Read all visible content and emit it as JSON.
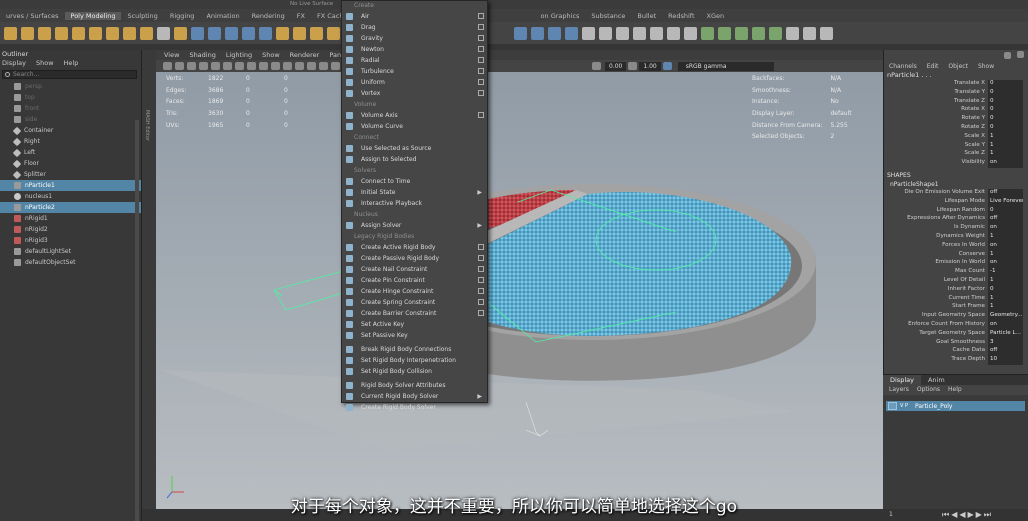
{
  "top": {
    "status": "No Live Surface"
  },
  "shelf_tabs": [
    "urves / Surfaces",
    "Poly Modeling",
    "Sculpting",
    "Rigging",
    "Animation",
    "Rendering",
    "FX",
    "FX Caching",
    "on Graphics",
    "Substance",
    "Bullet",
    "Redshift",
    "XGen"
  ],
  "outliner": {
    "title": "Outliner",
    "menu": [
      "Display",
      "Show",
      "Help"
    ],
    "search_placeholder": "Search...",
    "items": [
      {
        "label": "persp",
        "dim": true
      },
      {
        "label": "top",
        "dim": true
      },
      {
        "label": "front",
        "dim": true
      },
      {
        "label": "side",
        "dim": true
      },
      {
        "label": "Container",
        "dim": false
      },
      {
        "label": "Right",
        "dim": false
      },
      {
        "label": "Left",
        "dim": false
      },
      {
        "label": "Floor",
        "dim": false
      },
      {
        "label": "Splitter",
        "dim": false
      },
      {
        "label": "nParticle1",
        "dim": false,
        "selected": true
      },
      {
        "label": "nucleus1",
        "dim": false
      },
      {
        "label": "nParticle2",
        "dim": false,
        "selected": true
      },
      {
        "label": "nRigid1",
        "dim": false
      },
      {
        "label": "nRigid2",
        "dim": false
      },
      {
        "label": "nRigid3",
        "dim": false
      },
      {
        "label": "defaultLightSet",
        "dim": false
      },
      {
        "label": "defaultObjectSet",
        "dim": false
      }
    ]
  },
  "viewport": {
    "menu": [
      "View",
      "Shading",
      "Lighting",
      "Show",
      "Renderer",
      "Panels"
    ],
    "side_label": "MASH Editor",
    "val1": "0.00",
    "val2": "1.00",
    "colorspace": "sRGB gamma",
    "hud_left": [
      {
        "label": "Verts:",
        "a": "1822",
        "b": "0",
        "c": "0"
      },
      {
        "label": "Edges:",
        "a": "3686",
        "b": "0",
        "c": "0"
      },
      {
        "label": "Faces:",
        "a": "1869",
        "b": "0",
        "c": "0"
      },
      {
        "label": "Tris:",
        "a": "3630",
        "b": "0",
        "c": "0"
      },
      {
        "label": "UVs:",
        "a": "1965",
        "b": "0",
        "c": "0"
      }
    ],
    "hud_right": [
      {
        "label": "Backfaces:",
        "value": "N/A"
      },
      {
        "label": "Smoothness:",
        "value": "N/A"
      },
      {
        "label": "Instance:",
        "value": "No"
      },
      {
        "label": "Display Layer:",
        "value": "default"
      },
      {
        "label": "Distance From Camera:",
        "value": "5.255"
      },
      {
        "label": "Selected Objects:",
        "value": "2"
      }
    ]
  },
  "create_menu": {
    "items": [
      {
        "label": "Create",
        "section": true
      },
      {
        "label": "Air",
        "option": true
      },
      {
        "label": "Drag",
        "option": true
      },
      {
        "label": "Gravity",
        "option": true
      },
      {
        "label": "Newton",
        "option": true
      },
      {
        "label": "Radial",
        "option": true
      },
      {
        "label": "Turbulence",
        "option": true
      },
      {
        "label": "Uniform",
        "option": true
      },
      {
        "label": "Vortex",
        "option": true
      },
      {
        "label": "Volume",
        "section": true
      },
      {
        "label": "Volume Axis",
        "option": true
      },
      {
        "label": "Volume Curve"
      },
      {
        "label": "Connect",
        "section": true
      },
      {
        "label": "Use Selected as Source"
      },
      {
        "label": "Assign to Selected"
      },
      {
        "label": "Solvers",
        "section": true
      },
      {
        "label": "Connect to Time"
      },
      {
        "label": "Initial State",
        "submenu": true
      },
      {
        "label": "Interactive Playback"
      },
      {
        "label": "Nucleus",
        "section": true
      },
      {
        "label": "Assign Solver",
        "submenu": true
      },
      {
        "label": "Legacy Rigid Bodies",
        "section": true
      },
      {
        "label": "Create Active Rigid Body",
        "option": true
      },
      {
        "label": "Create Passive Rigid Body",
        "option": true
      },
      {
        "label": "Create Nail Constraint",
        "option": true
      },
      {
        "label": "Create Pin Constraint",
        "option": true
      },
      {
        "label": "Create Hinge Constraint",
        "option": true
      },
      {
        "label": "Create Spring Constraint",
        "option": true
      },
      {
        "label": "Create Barrier Constraint",
        "option": true
      },
      {
        "label": "Set Active Key"
      },
      {
        "label": "Set Passive Key"
      },
      {
        "label": "Break Rigid Body Connections"
      },
      {
        "label": "Set Rigid Body Interpenetration"
      },
      {
        "label": "Set Rigid Body Collision"
      },
      {
        "label": "Rigid Body Solver Attributes"
      },
      {
        "label": "Current Rigid Body Solver",
        "submenu": true
      },
      {
        "label": "Create Rigid Body Solver"
      }
    ]
  },
  "channel_box": {
    "tabs": [
      "Channels",
      "Edit",
      "Object",
      "Show"
    ],
    "object": "nParticle1 . . .",
    "transform": [
      {
        "label": "Translate X",
        "value": "0"
      },
      {
        "label": "Translate Y",
        "value": "0"
      },
      {
        "label": "Translate Z",
        "value": "0"
      },
      {
        "label": "Rotate X",
        "value": "0"
      },
      {
        "label": "Rotate Y",
        "value": "0"
      },
      {
        "label": "Rotate Z",
        "value": "0"
      },
      {
        "label": "Scale X",
        "value": "1"
      },
      {
        "label": "Scale Y",
        "value": "1"
      },
      {
        "label": "Scale Z",
        "value": "1"
      },
      {
        "label": "Visibility",
        "value": "on"
      }
    ],
    "shapes_title": "SHAPES",
    "shape_name": "nParticleShape1",
    "shape_attrs": [
      {
        "label": "Die On Emission Volume Exit",
        "value": "off"
      },
      {
        "label": "Lifespan Mode",
        "value": "Live Forever"
      },
      {
        "label": "Lifespan Random",
        "value": "0"
      },
      {
        "label": "Expressions After Dynamics",
        "value": "off"
      },
      {
        "label": "Is Dynamic",
        "value": "on"
      },
      {
        "label": "Dynamics Weight",
        "value": "1"
      },
      {
        "label": "Forces In World",
        "value": "on"
      },
      {
        "label": "Conserve",
        "value": "1"
      },
      {
        "label": "Emission In World",
        "value": "on"
      },
      {
        "label": "Max Count",
        "value": "-1"
      },
      {
        "label": "Level Of Detail",
        "value": "1"
      },
      {
        "label": "Inherit Factor",
        "value": "0"
      },
      {
        "label": "Current Time",
        "value": "1"
      },
      {
        "label": "Start Frame",
        "value": "1"
      },
      {
        "label": "Input Geometry Space",
        "value": "Geometry..."
      },
      {
        "label": "Enforce Count From History",
        "value": "on"
      },
      {
        "label": "Target Geometry Space",
        "value": "Particle L..."
      },
      {
        "label": "Goal Smoothness",
        "value": "3"
      },
      {
        "label": "Cache Data",
        "value": "off"
      },
      {
        "label": "Trace Depth",
        "value": "10"
      }
    ]
  },
  "layers": {
    "tabs": [
      "Display",
      "Anim"
    ],
    "menu": [
      "Layers",
      "Options",
      "Help"
    ],
    "layer_flags": "V  P",
    "layer_name": "Particle_Poly"
  },
  "timeline": {
    "end_frame": "1"
  },
  "subtitle": "对于每个对象，这并不重要，所以你可以简单地选择这个go"
}
